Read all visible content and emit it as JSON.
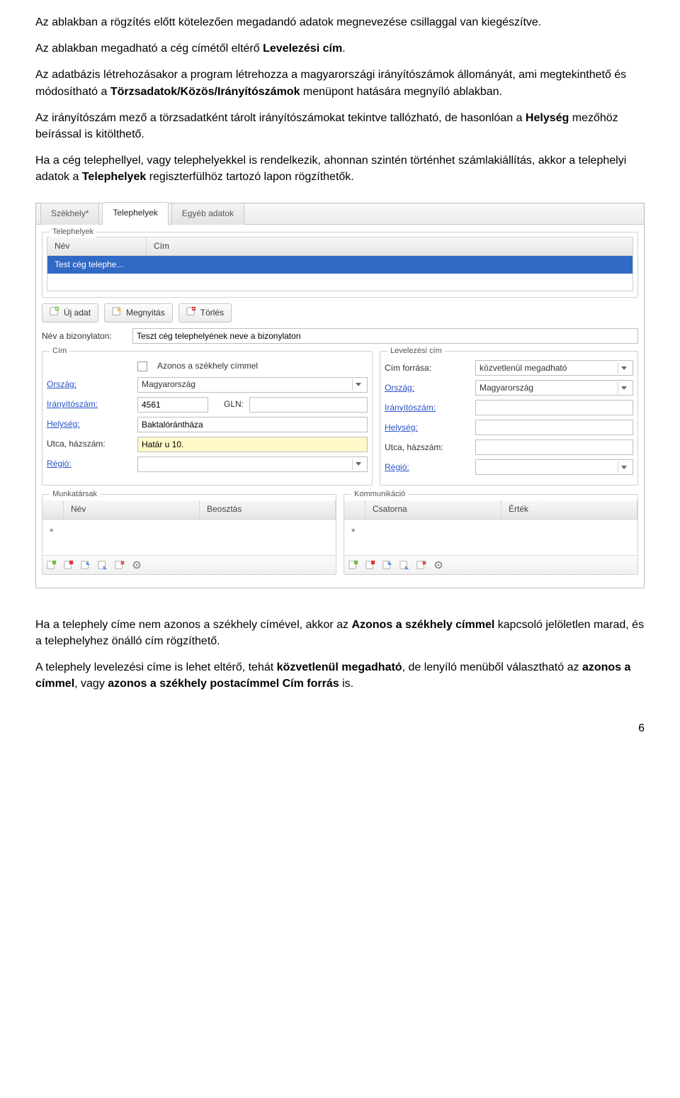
{
  "doc": {
    "p1_a": "Az ablakban a rögzítés előtt kötelezően megadandó adatok megnevezése csillaggal van kiegészítve.",
    "p2_a": "Az ablakban megadható a cég címétől eltérő ",
    "p2_b": "Levelezési cím",
    "p2_c": ".",
    "p3_a": "Az adatbázis létrehozásakor a program létrehozza a magyarországi irányítószámok állományát, ami megtekinthető és módosítható a ",
    "p3_b": "Törzsadatok/Közös/Irányítószámok",
    "p3_c": " menüpont hatására megnyíló ablakban.",
    "p4_a": "Az irányítószám mező a törzsadatként tárolt irányítószámokat tekintve tallózható, de hasonlóan a ",
    "p4_b": "Helység",
    "p4_c": " mezőhöz beírással is kitölthető.",
    "p5_a": "Ha a cég telephellyel, vagy telephelyekkel is rendelkezik, ahonnan szintén történhet számlakiállítás, akkor a telephelyi adatok a ",
    "p5_b": "Telephelyek",
    "p5_c": " regiszterfülhöz tartozó lapon rögzíthetők.",
    "b1_a": "Ha a telephely címe nem azonos a székhely címével, akkor az ",
    "b1_b": "Azonos a székhely címmel",
    "b1_c": " kapcsoló jelöletlen marad, és a telephelyhez önálló cím rögzíthető.",
    "b2_a": "A telephely levelezési címe is lehet eltérő, tehát ",
    "b2_b": "közvetlenül megadható",
    "b2_c": ", de lenyíló menüből választható az ",
    "b2_d": "azonos a címmel",
    "b2_e": ", vagy ",
    "b2_f": "azonos a székhely postacímmel Cím forrás",
    "b2_g": " is.",
    "page_number": "6"
  },
  "app": {
    "tabs": [
      {
        "label": "Székhely*"
      },
      {
        "label": "Telephelyek",
        "active": true
      },
      {
        "label": "Egyéb adatok"
      }
    ],
    "list": {
      "legend": "Telephelyek",
      "columns": {
        "name": "Név",
        "cim": "Cím"
      },
      "row": {
        "name": "Test cég telephe...",
        "cim": ""
      }
    },
    "buttons": {
      "new": "Új adat",
      "open": "Megnyitás",
      "delete": "Törlés"
    },
    "name_row": {
      "label": "Név a bizonylaton:",
      "value": "Teszt cég telephelyének neve a bizonylaton"
    },
    "cim": {
      "legend": "Cím",
      "checkbox_label": "Azonos a székhely címmel",
      "orszag_label": "Ország:",
      "orszag_value": "Magyarország",
      "irsz_label": "Irányítószám:",
      "irsz_value": "4561",
      "gln_label": "GLN:",
      "gln_value": "",
      "helyseg_label": "Helység:",
      "helyseg_value": "Baktalórántháza",
      "utca_label": "Utca, házszám:",
      "utca_value": "Határ u 10.",
      "regio_label": "Régió:",
      "regio_value": ""
    },
    "lev": {
      "legend": "Levelezési cím",
      "source_label": "Cím forrása:",
      "source_value": "közvetlenül megadható",
      "orszag_label": "Ország:",
      "orszag_value": "Magyarország",
      "irsz_label": "Irányítószám:",
      "irsz_value": "",
      "helyseg_label": "Helység:",
      "helyseg_value": "",
      "utca_label": "Utca, házszám:",
      "utca_value": "",
      "regio_label": "Régió:",
      "regio_value": ""
    },
    "munkatarsak": {
      "legend": "Munkatársak",
      "col_name": "Név",
      "col_role": "Beosztás"
    },
    "komm": {
      "legend": "Kommunikáció",
      "col_channel": "Csatorna",
      "col_value": "Érték"
    }
  }
}
